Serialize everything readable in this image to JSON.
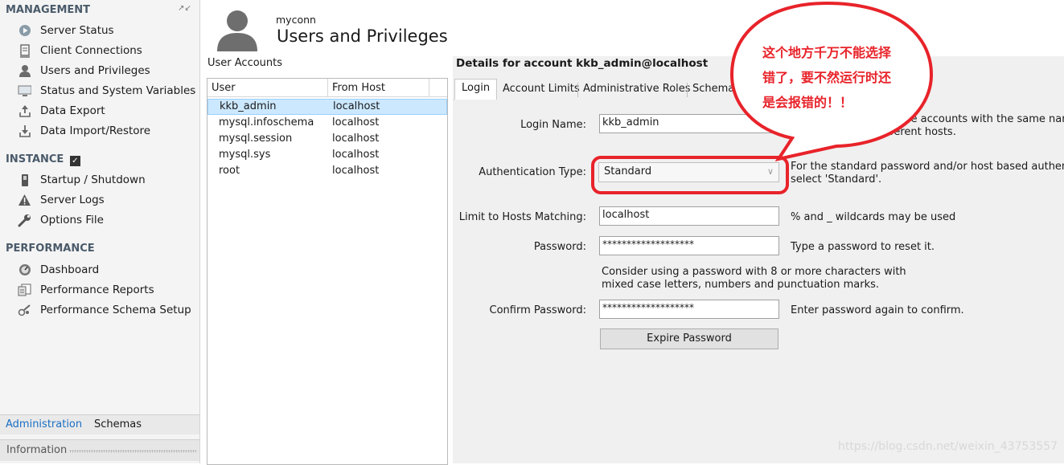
{
  "sidebar": {
    "management_title": "MANAGEMENT",
    "management_items": [
      {
        "label": "Server Status",
        "icon": "play-circle-icon"
      },
      {
        "label": "Client Connections",
        "icon": "connections-icon"
      },
      {
        "label": "Users and Privileges",
        "icon": "user-icon"
      },
      {
        "label": "Status and System Variables",
        "icon": "monitor-icon"
      },
      {
        "label": "Data Export",
        "icon": "export-icon"
      },
      {
        "label": "Data Import/Restore",
        "icon": "import-icon"
      }
    ],
    "instance_title": "INSTANCE",
    "instance_items": [
      {
        "label": "Startup / Shutdown",
        "icon": "power-switch-icon"
      },
      {
        "label": "Server Logs",
        "icon": "warning-icon"
      },
      {
        "label": "Options File",
        "icon": "wrench-icon"
      }
    ],
    "performance_title": "PERFORMANCE",
    "performance_items": [
      {
        "label": "Dashboard",
        "icon": "dashboard-gauge-icon"
      },
      {
        "label": "Performance Reports",
        "icon": "reports-icon"
      },
      {
        "label": "Performance Schema Setup",
        "icon": "schema-setup-icon"
      }
    ],
    "bottom_tabs": [
      "Administration",
      "Schemas"
    ],
    "info_label": "Information"
  },
  "header": {
    "connection": "myconn",
    "title": "Users and Privileges"
  },
  "user_accounts": {
    "label": "User Accounts",
    "columns": [
      "User",
      "From Host"
    ],
    "rows": [
      {
        "user": "kkb_admin",
        "host": "localhost",
        "selected": true
      },
      {
        "user": "mysql.infoschema",
        "host": "localhost"
      },
      {
        "user": "mysql.session",
        "host": "localhost"
      },
      {
        "user": "mysql.sys",
        "host": "localhost"
      },
      {
        "user": "root",
        "host": "localhost"
      }
    ]
  },
  "details": {
    "title": "Details for account kkb_admin@localhost",
    "tabs": [
      "Login",
      "Account Limits",
      "Administrative Roles",
      "Schema Privileges"
    ],
    "login": {
      "login_name_label": "Login Name:",
      "login_name_value": "kkb_admin",
      "login_name_hint_1": "You may create multiple accounts with the same name",
      "login_name_hint_2": "to connect from different hosts.",
      "auth_type_label": "Authentication Type:",
      "auth_type_value": "Standard",
      "auth_type_hint_1": "For the standard password and/or host based authentica",
      "auth_type_hint_2": "select 'Standard'.",
      "hosts_label": "Limit to Hosts Matching:",
      "hosts_value": "localhost",
      "hosts_hint": "% and _ wildcards may be used",
      "password_label": "Password:",
      "password_value": "*******************",
      "password_hint": "Type a password to reset it.",
      "password_advice_1": "Consider using a password with 8 or more characters with",
      "password_advice_2": "mixed case letters, numbers and punctuation marks.",
      "confirm_label": "Confirm Password:",
      "confirm_value": "*******************",
      "confirm_hint": "Enter password again to confirm.",
      "expire_button": "Expire Password"
    }
  },
  "annotation": {
    "line1": "这个地方千万不能选择",
    "line2": "错了，要不然运行时还",
    "line3": "是会报错的！！",
    "color": "#e8232a"
  },
  "watermark": "https://blog.csdn.net/weixin_43753557"
}
